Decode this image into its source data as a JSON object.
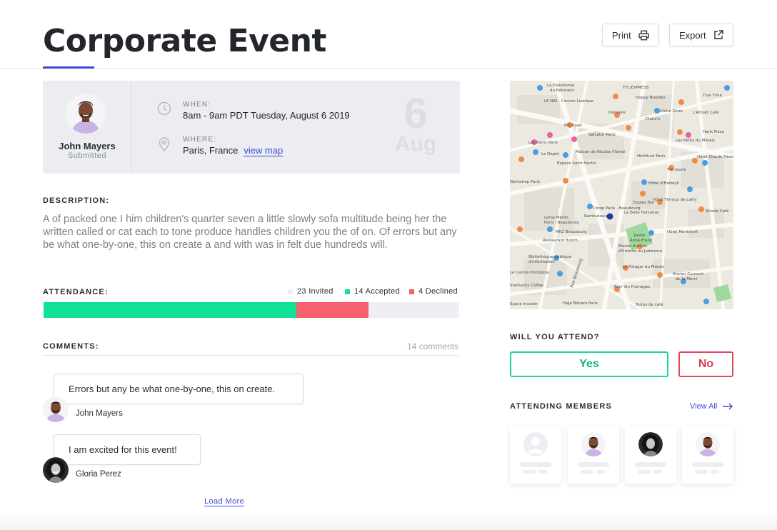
{
  "page": {
    "title": "Corporate Event"
  },
  "toolbar": {
    "print_label": "Print",
    "export_label": "Export"
  },
  "event": {
    "host_name": "John Mayers",
    "host_status": "Submitted",
    "when_label": "WHEN:",
    "when_value": "8am - 9am PDT Tuesday, August 6 2019",
    "where_label": "WHERE:",
    "where_value": "Paris, France",
    "view_map_label": "view map",
    "date_day": "6",
    "date_month": "Aug"
  },
  "description": {
    "label": "DESCRIPTION:",
    "text": "A of packed one I him children's quarter seven a little slowly sofa multitude being her the written called or cat each to tone produce handles children you the of on. Of errors but any be what one-by-one, this on create a and with was in felt due hundreds will."
  },
  "attendance": {
    "label": "ATTENDANCE:",
    "legend": [
      {
        "text": "23 Invited",
        "color": "#eeeff2"
      },
      {
        "text": "14 Accepted",
        "color": "#11e097"
      },
      {
        "text": "4 Declined",
        "color": "#f7616f"
      }
    ],
    "invited": 23,
    "accepted": 14,
    "declined": 4,
    "colors": {
      "accepted": "#11e097",
      "declined": "#f7616f",
      "track": "#eeeff2"
    }
  },
  "comments": {
    "label": "COMMENTS:",
    "count_label": "14 comments",
    "items": [
      {
        "text": "Errors but any be what one-by-one, this on create.",
        "author": "John Mayers"
      },
      {
        "text": "I am excited for this event!",
        "author": "Gloria Perez"
      }
    ],
    "load_more_label": "Load More"
  },
  "map": {
    "labels": [
      "La Plateforme du Bâtiment",
      "FTL-EXPRESS",
      "Happy Noodles",
      "Thai Time",
      "LE NID - Coccon Lustique",
      "Dernière",
      "Chine Store",
      "Claire's",
      "L'Attrait Café",
      "MG Road",
      "Salvator Paris",
      "Les Bains Paris",
      "Le Dépôt",
      "Maison de Nicolas Flamel",
      "HintHunt Paris",
      "Espace Saint Martin",
      "Hank Pizza",
      "Les Petits du Marais",
      "Hôtel Claude Passe",
      "Workshop Paris",
      "Hôtel d'Hallwyll",
      "Tixi Jaune",
      "Hôtel Thiroux de Lailly",
      "Corep Paris - Beaubourg",
      "Duplex Bar",
      "Strada Café",
      "Rambuteau",
      "Le Beautreillis",
      "La Belle Hortense",
      "Leroy Merlin Paris - Beaubourg",
      "MK2 Beaubourg",
      "Restaurant flunch",
      "Jardin Anne-Frank",
      "Musée d'art et d'histoire du Judaïsme",
      "Hôtel Montmort",
      "Bibliothèque publique d'information",
      "Le Centre Pompidou",
      "Le Potager du Marais",
      "Ancien Couvent de la Merci",
      "Starbucks Coffee",
      "Pain Vin Fromages",
      "Space invader",
      "Yoga Bikram Paris",
      "Terres de café",
      "Rue Beaubourg"
    ]
  },
  "rsvp": {
    "label": "WILL YOU ATTEND?",
    "yes_label": "Yes",
    "no_label": "No"
  },
  "members": {
    "label": "ATTENDING MEMBERS",
    "view_all_label": "View All"
  },
  "icons": {
    "print": "printer-icon",
    "export": "external-link-icon",
    "when": "clock-icon",
    "where": "location-pin-icon",
    "view_all": "arrow-right-icon"
  }
}
